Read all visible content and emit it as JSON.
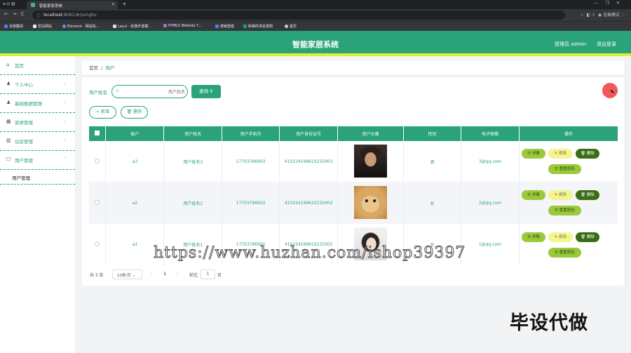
{
  "browser": {
    "tab_title": "智能家居系统",
    "url_host": "localhost",
    "url_rest": ":8081/#/yonghu",
    "profile": "无痕模式",
    "bookmarks": [
      "百度翻译",
      "爱站网站",
      "Element - 网站快...",
      "Layui - 经典开源模...",
      "HTML5 Website T...",
      "搜索壁纸",
      "新峰的求名规则",
      "首页"
    ]
  },
  "header": {
    "title": "智能家居系统",
    "admin": "管理员 admin",
    "logout": "退出登录"
  },
  "sidebar": {
    "items": [
      {
        "label": "首页",
        "icon": "home-icon"
      },
      {
        "label": "个人中心",
        "icon": "user-icon"
      },
      {
        "label": "基础数据管理",
        "icon": "user-icon"
      },
      {
        "label": "家居管理",
        "icon": "grid-icon"
      },
      {
        "label": "住房管理",
        "icon": "building-icon"
      },
      {
        "label": "用户管理",
        "icon": "square-icon"
      }
    ],
    "sub_item": "用户管理"
  },
  "breadcrumb": {
    "home": "首页",
    "sep": "/",
    "current": "用户"
  },
  "search": {
    "label": "用户姓名",
    "placeholder": "用户姓名",
    "query_button": "查询",
    "add_button": "+ 新增",
    "delete_button": "删除"
  },
  "table": {
    "headers": [
      "账户",
      "用户姓名",
      "用户手机号",
      "用户身份证号",
      "用户头像",
      "性别",
      "电子邮箱",
      "操作"
    ],
    "rows": [
      {
        "account": "a3",
        "name": "用户姓名3",
        "phone": "17703786903",
        "idcard": "410224199610232003",
        "gender": "男",
        "email": "3@qq.com"
      },
      {
        "account": "a2",
        "name": "用户姓名2",
        "phone": "17703786902",
        "idcard": "410224199610232002",
        "gender": "女",
        "email": "2@qq.com"
      },
      {
        "account": "a1",
        "name": "用户姓名1",
        "phone": "17703786901",
        "idcard": "410224199610232001",
        "gender": "女",
        "email": "1@qq.com"
      }
    ],
    "actions": {
      "detail": "详情",
      "edit": "修改",
      "delete": "删除",
      "reset": "重置密码"
    }
  },
  "pagination": {
    "total": "共 3 条",
    "page_size": "10条/页",
    "current_page": "1",
    "goto_label": "前往",
    "goto_value": "1",
    "page_suffix": "页"
  },
  "watermark": {
    "url": "https://www.huzhan.com/ishop39397",
    "corner": "毕设代做"
  }
}
